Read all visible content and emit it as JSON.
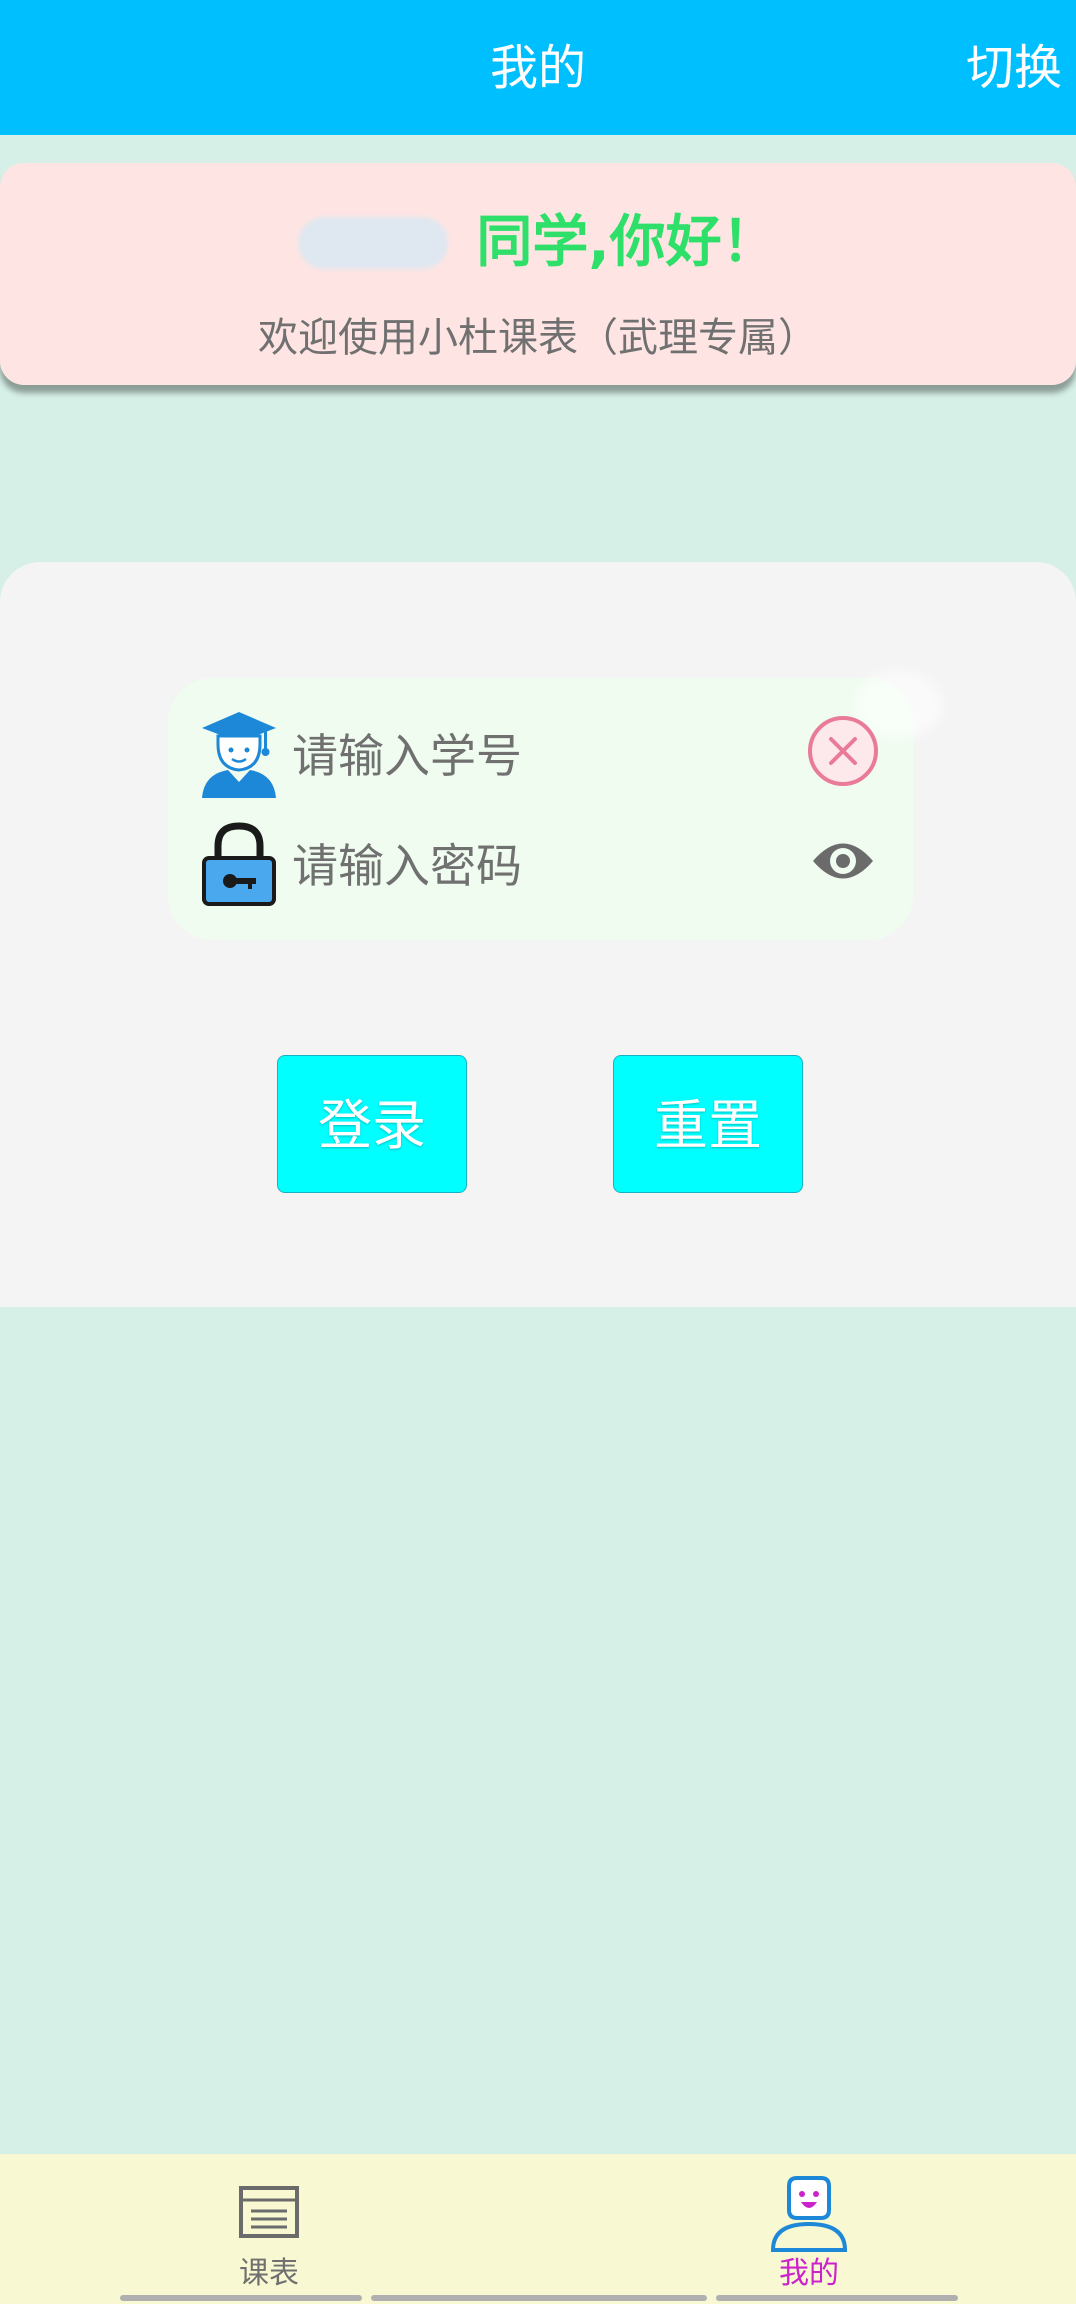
{
  "header": {
    "title": "我的",
    "switch_label": "切换"
  },
  "greeting": {
    "hello_text": "同学,你好！",
    "welcome_text": "欢迎使用小杜课表（武理专属）"
  },
  "login_form": {
    "student_id_placeholder": "请输入学号",
    "password_placeholder": "请输入密码",
    "login_label": "登录",
    "reset_label": "重置"
  },
  "bottom_nav": {
    "items": [
      {
        "label": "课表",
        "icon": "schedule-icon",
        "active": false
      },
      {
        "label": "我的",
        "icon": "profile-icon",
        "active": true
      }
    ]
  },
  "colors": {
    "app_bar": "#00bfff",
    "page_bg": "#d6f0e7",
    "greeting_card": "#fee5e3",
    "greeting_text": "#2ee06a",
    "button_bg": "#00ffff",
    "active_tab": "#cc22cc",
    "bottom_nav_bg": "#f8f8d2"
  }
}
